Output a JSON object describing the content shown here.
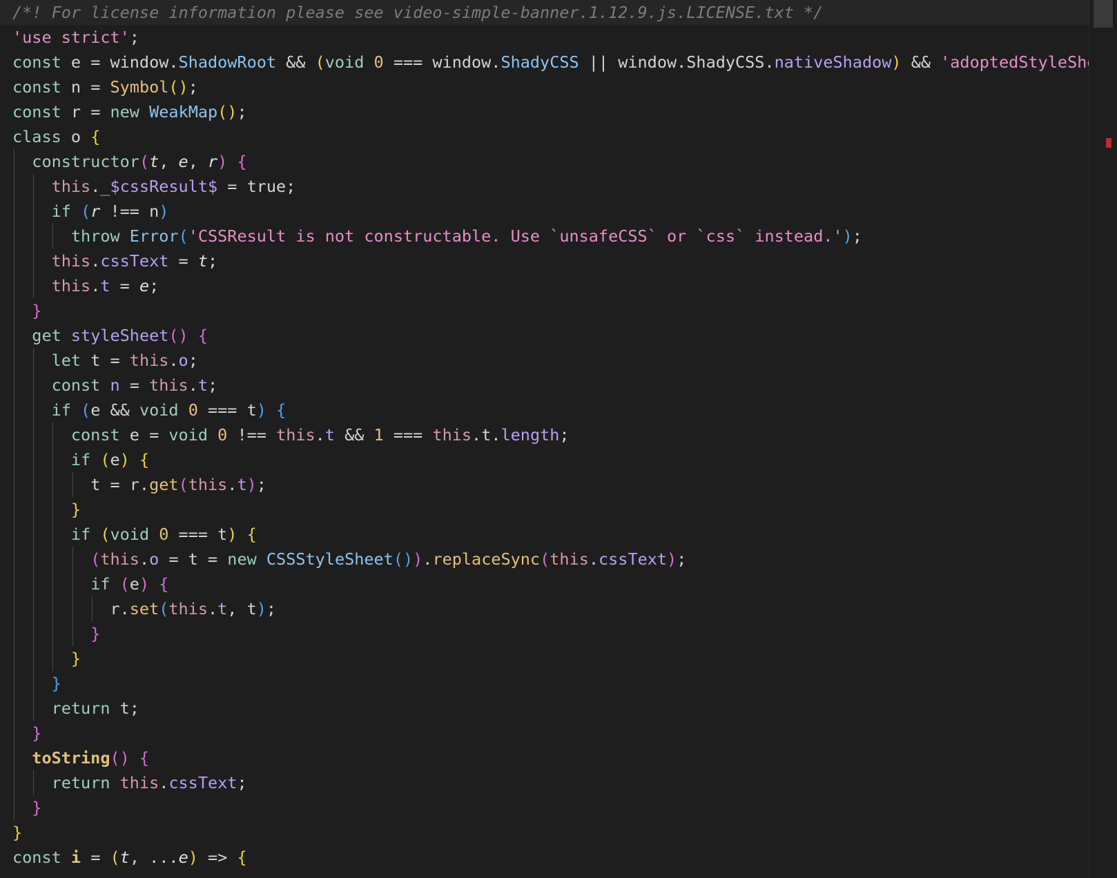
{
  "editor": {
    "lines": [
      {
        "indent": 0,
        "tokens": [
          {
            "t": "/*! For license information please see video-simple-banner.1.12.9.js.LICENSE.txt */",
            "c": "comment"
          }
        ]
      },
      {
        "indent": 0,
        "tokens": [
          {
            "t": "'use strict'",
            "c": "str"
          },
          {
            "t": ";",
            "c": "plain"
          }
        ]
      },
      {
        "indent": 0,
        "tokens": [
          {
            "t": "const",
            "c": "kw"
          },
          {
            "t": " e = window.",
            "c": "plain"
          },
          {
            "t": "ShadowRoot",
            "c": "cls"
          },
          {
            "t": " && ",
            "c": "plain"
          },
          {
            "t": "(",
            "c": "b1"
          },
          {
            "t": "void",
            "c": "kw"
          },
          {
            "t": " ",
            "c": "plain"
          },
          {
            "t": "0",
            "c": "num"
          },
          {
            "t": " === window.",
            "c": "plain"
          },
          {
            "t": "ShadyCSS",
            "c": "cls"
          },
          {
            "t": " || window.ShadyCSS.",
            "c": "plain"
          },
          {
            "t": "nativeShadow",
            "c": "meth"
          },
          {
            "t": ")",
            "c": "b1"
          },
          {
            "t": " && ",
            "c": "plain"
          },
          {
            "t": "'adoptedStyleSheets' in Document.prototype",
            "c": "str"
          }
        ]
      },
      {
        "indent": 0,
        "tokens": [
          {
            "t": "const",
            "c": "kw"
          },
          {
            "t": " n = ",
            "c": "plain"
          },
          {
            "t": "Symbol",
            "c": "fn"
          },
          {
            "t": "()",
            "c": "b1"
          },
          {
            "t": ";",
            "c": "plain"
          }
        ]
      },
      {
        "indent": 0,
        "tokens": [
          {
            "t": "const",
            "c": "kw"
          },
          {
            "t": " r = ",
            "c": "plain"
          },
          {
            "t": "new",
            "c": "kw"
          },
          {
            "t": " ",
            "c": "plain"
          },
          {
            "t": "WeakMap",
            "c": "cls"
          },
          {
            "t": "()",
            "c": "b1"
          },
          {
            "t": ";",
            "c": "plain"
          }
        ]
      },
      {
        "indent": 0,
        "tokens": [
          {
            "t": "class",
            "c": "kw"
          },
          {
            "t": " o ",
            "c": "plain"
          },
          {
            "t": "{",
            "c": "b1"
          }
        ]
      },
      {
        "indent": 1,
        "tokens": [
          {
            "t": "constructor",
            "c": "kw"
          },
          {
            "t": "(",
            "c": "b2"
          },
          {
            "t": "t",
            "c": "par"
          },
          {
            "t": ", ",
            "c": "plain"
          },
          {
            "t": "e",
            "c": "par"
          },
          {
            "t": ", ",
            "c": "plain"
          },
          {
            "t": "r",
            "c": "par"
          },
          {
            "t": ")",
            "c": "b2"
          },
          {
            "t": " ",
            "c": "plain"
          },
          {
            "t": "{",
            "c": "b2"
          }
        ]
      },
      {
        "indent": 2,
        "tokens": [
          {
            "t": "this",
            "c": "mem"
          },
          {
            "t": ".",
            "c": "plain"
          },
          {
            "t": "_$cssResult$",
            "c": "meth"
          },
          {
            "t": " = true;",
            "c": "plain"
          }
        ]
      },
      {
        "indent": 2,
        "tokens": [
          {
            "t": "if",
            "c": "kw"
          },
          {
            "t": " ",
            "c": "plain"
          },
          {
            "t": "(",
            "c": "b3"
          },
          {
            "t": "r",
            "c": "par"
          },
          {
            "t": " !== n",
            "c": "plain"
          },
          {
            "t": ")",
            "c": "b3"
          }
        ]
      },
      {
        "indent": 3,
        "tokens": [
          {
            "t": "throw",
            "c": "kw"
          },
          {
            "t": " ",
            "c": "plain"
          },
          {
            "t": "Error",
            "c": "cls"
          },
          {
            "t": "(",
            "c": "b3"
          },
          {
            "t": "'CSSResult is not constructable. Use `unsafeCSS` or `css` instead.'",
            "c": "str"
          },
          {
            "t": ")",
            "c": "b3"
          },
          {
            "t": ";",
            "c": "plain"
          }
        ]
      },
      {
        "indent": 2,
        "tokens": [
          {
            "t": "this",
            "c": "mem"
          },
          {
            "t": ".",
            "c": "plain"
          },
          {
            "t": "cssText",
            "c": "meth"
          },
          {
            "t": " = ",
            "c": "plain"
          },
          {
            "t": "t",
            "c": "par"
          },
          {
            "t": ";",
            "c": "plain"
          }
        ]
      },
      {
        "indent": 2,
        "tokens": [
          {
            "t": "this",
            "c": "mem"
          },
          {
            "t": ".",
            "c": "plain"
          },
          {
            "t": "t",
            "c": "meth"
          },
          {
            "t": " = ",
            "c": "plain"
          },
          {
            "t": "e",
            "c": "par"
          },
          {
            "t": ";",
            "c": "plain"
          }
        ]
      },
      {
        "indent": 1,
        "tokens": [
          {
            "t": "}",
            "c": "b2"
          }
        ]
      },
      {
        "indent": 1,
        "tokens": [
          {
            "t": "get",
            "c": "kw"
          },
          {
            "t": " ",
            "c": "plain"
          },
          {
            "t": "styleSheet",
            "c": "meth"
          },
          {
            "t": "()",
            "c": "b2"
          },
          {
            "t": " ",
            "c": "plain"
          },
          {
            "t": "{",
            "c": "b2"
          }
        ]
      },
      {
        "indent": 2,
        "tokens": [
          {
            "t": "let",
            "c": "kw"
          },
          {
            "t": " t = ",
            "c": "plain"
          },
          {
            "t": "this",
            "c": "mem"
          },
          {
            "t": ".",
            "c": "plain"
          },
          {
            "t": "o",
            "c": "meth"
          },
          {
            "t": ";",
            "c": "plain"
          }
        ]
      },
      {
        "indent": 2,
        "tokens": [
          {
            "t": "const",
            "c": "kw"
          },
          {
            "t": " ",
            "c": "plain"
          },
          {
            "t": "n",
            "c": "meth"
          },
          {
            "t": " = ",
            "c": "plain"
          },
          {
            "t": "this",
            "c": "mem"
          },
          {
            "t": ".",
            "c": "plain"
          },
          {
            "t": "t",
            "c": "meth"
          },
          {
            "t": ";",
            "c": "plain"
          }
        ]
      },
      {
        "indent": 2,
        "tokens": [
          {
            "t": "if",
            "c": "kw"
          },
          {
            "t": " ",
            "c": "plain"
          },
          {
            "t": "(",
            "c": "b3"
          },
          {
            "t": "e && ",
            "c": "plain"
          },
          {
            "t": "void",
            "c": "kw"
          },
          {
            "t": " ",
            "c": "plain"
          },
          {
            "t": "0",
            "c": "num"
          },
          {
            "t": " === t",
            "c": "plain"
          },
          {
            "t": ")",
            "c": "b3"
          },
          {
            "t": " ",
            "c": "plain"
          },
          {
            "t": "{",
            "c": "b3"
          }
        ]
      },
      {
        "indent": 3,
        "tokens": [
          {
            "t": "const",
            "c": "kw"
          },
          {
            "t": " e = ",
            "c": "plain"
          },
          {
            "t": "void",
            "c": "kw"
          },
          {
            "t": " ",
            "c": "plain"
          },
          {
            "t": "0",
            "c": "num"
          },
          {
            "t": " !== ",
            "c": "plain"
          },
          {
            "t": "this",
            "c": "mem"
          },
          {
            "t": ".",
            "c": "plain"
          },
          {
            "t": "t",
            "c": "meth"
          },
          {
            "t": " && ",
            "c": "plain"
          },
          {
            "t": "1",
            "c": "num"
          },
          {
            "t": " === ",
            "c": "plain"
          },
          {
            "t": "this",
            "c": "mem"
          },
          {
            "t": ".t.",
            "c": "plain"
          },
          {
            "t": "length",
            "c": "meth"
          },
          {
            "t": ";",
            "c": "plain"
          }
        ]
      },
      {
        "indent": 3,
        "tokens": [
          {
            "t": "if",
            "c": "kw"
          },
          {
            "t": " ",
            "c": "plain"
          },
          {
            "t": "(",
            "c": "b1"
          },
          {
            "t": "e",
            "c": "plain"
          },
          {
            "t": ")",
            "c": "b1"
          },
          {
            "t": " ",
            "c": "plain"
          },
          {
            "t": "{",
            "c": "b1"
          }
        ]
      },
      {
        "indent": 4,
        "tokens": [
          {
            "t": "t = r.",
            "c": "plain"
          },
          {
            "t": "get",
            "c": "fn"
          },
          {
            "t": "(",
            "c": "b2"
          },
          {
            "t": "this",
            "c": "mem"
          },
          {
            "t": ".",
            "c": "plain"
          },
          {
            "t": "t",
            "c": "meth"
          },
          {
            "t": ")",
            "c": "b2"
          },
          {
            "t": ";",
            "c": "plain"
          }
        ]
      },
      {
        "indent": 3,
        "tokens": [
          {
            "t": "}",
            "c": "b1"
          }
        ]
      },
      {
        "indent": 3,
        "tokens": [
          {
            "t": "if",
            "c": "kw"
          },
          {
            "t": " ",
            "c": "plain"
          },
          {
            "t": "(",
            "c": "b1"
          },
          {
            "t": "void",
            "c": "kw"
          },
          {
            "t": " ",
            "c": "plain"
          },
          {
            "t": "0",
            "c": "num"
          },
          {
            "t": " === t",
            "c": "plain"
          },
          {
            "t": ")",
            "c": "b1"
          },
          {
            "t": " ",
            "c": "plain"
          },
          {
            "t": "{",
            "c": "b1"
          }
        ]
      },
      {
        "indent": 4,
        "tokens": [
          {
            "t": "(",
            "c": "b2"
          },
          {
            "t": "this",
            "c": "mem"
          },
          {
            "t": ".",
            "c": "plain"
          },
          {
            "t": "o",
            "c": "meth"
          },
          {
            "t": " = t = ",
            "c": "plain"
          },
          {
            "t": "new",
            "c": "kw"
          },
          {
            "t": " ",
            "c": "plain"
          },
          {
            "t": "CSSStyleSheet",
            "c": "cls"
          },
          {
            "t": "()",
            "c": "b3"
          },
          {
            "t": ")",
            "c": "b2"
          },
          {
            "t": ".",
            "c": "plain"
          },
          {
            "t": "replaceSync",
            "c": "fn"
          },
          {
            "t": "(",
            "c": "b2"
          },
          {
            "t": "this",
            "c": "mem"
          },
          {
            "t": ".",
            "c": "plain"
          },
          {
            "t": "cssText",
            "c": "meth"
          },
          {
            "t": ")",
            "c": "b2"
          },
          {
            "t": ";",
            "c": "plain"
          }
        ]
      },
      {
        "indent": 4,
        "tokens": [
          {
            "t": "if",
            "c": "kw"
          },
          {
            "t": " ",
            "c": "plain"
          },
          {
            "t": "(",
            "c": "b2"
          },
          {
            "t": "e",
            "c": "plain"
          },
          {
            "t": ")",
            "c": "b2"
          },
          {
            "t": " ",
            "c": "plain"
          },
          {
            "t": "{",
            "c": "b2"
          }
        ]
      },
      {
        "indent": 5,
        "tokens": [
          {
            "t": "r.",
            "c": "plain"
          },
          {
            "t": "set",
            "c": "fn"
          },
          {
            "t": "(",
            "c": "b3"
          },
          {
            "t": "this",
            "c": "mem"
          },
          {
            "t": ".",
            "c": "plain"
          },
          {
            "t": "t",
            "c": "meth"
          },
          {
            "t": ", t",
            "c": "plain"
          },
          {
            "t": ")",
            "c": "b3"
          },
          {
            "t": ";",
            "c": "plain"
          }
        ]
      },
      {
        "indent": 4,
        "tokens": [
          {
            "t": "}",
            "c": "b2"
          }
        ]
      },
      {
        "indent": 3,
        "tokens": [
          {
            "t": "}",
            "c": "b1"
          }
        ]
      },
      {
        "indent": 2,
        "tokens": [
          {
            "t": "}",
            "c": "b3"
          }
        ]
      },
      {
        "indent": 2,
        "tokens": [
          {
            "t": "return",
            "c": "kw"
          },
          {
            "t": " t;",
            "c": "plain"
          }
        ]
      },
      {
        "indent": 1,
        "tokens": [
          {
            "t": "}",
            "c": "b2"
          }
        ]
      },
      {
        "indent": 1,
        "tokens": [
          {
            "t": "toString",
            "c": "fnb"
          },
          {
            "t": "()",
            "c": "b2"
          },
          {
            "t": " ",
            "c": "plain"
          },
          {
            "t": "{",
            "c": "b2"
          }
        ]
      },
      {
        "indent": 2,
        "tokens": [
          {
            "t": "return",
            "c": "kw"
          },
          {
            "t": " ",
            "c": "plain"
          },
          {
            "t": "this",
            "c": "mem"
          },
          {
            "t": ".",
            "c": "plain"
          },
          {
            "t": "cssText",
            "c": "meth"
          },
          {
            "t": ";",
            "c": "plain"
          }
        ]
      },
      {
        "indent": 1,
        "tokens": [
          {
            "t": "}",
            "c": "b2"
          }
        ]
      },
      {
        "indent": 0,
        "tokens": [
          {
            "t": "}",
            "c": "b1"
          }
        ]
      },
      {
        "indent": 0,
        "tokens": [
          {
            "t": "const",
            "c": "kw"
          },
          {
            "t": " ",
            "c": "plain"
          },
          {
            "t": "i",
            "c": "fnb"
          },
          {
            "t": " = ",
            "c": "plain"
          },
          {
            "t": "(",
            "c": "b1"
          },
          {
            "t": "t",
            "c": "par"
          },
          {
            "t": ", ...",
            "c": "plain"
          },
          {
            "t": "e",
            "c": "par"
          },
          {
            "t": ")",
            "c": "b1"
          },
          {
            "t": " => ",
            "c": "plain"
          },
          {
            "t": "{",
            "c": "b1"
          }
        ]
      }
    ]
  }
}
